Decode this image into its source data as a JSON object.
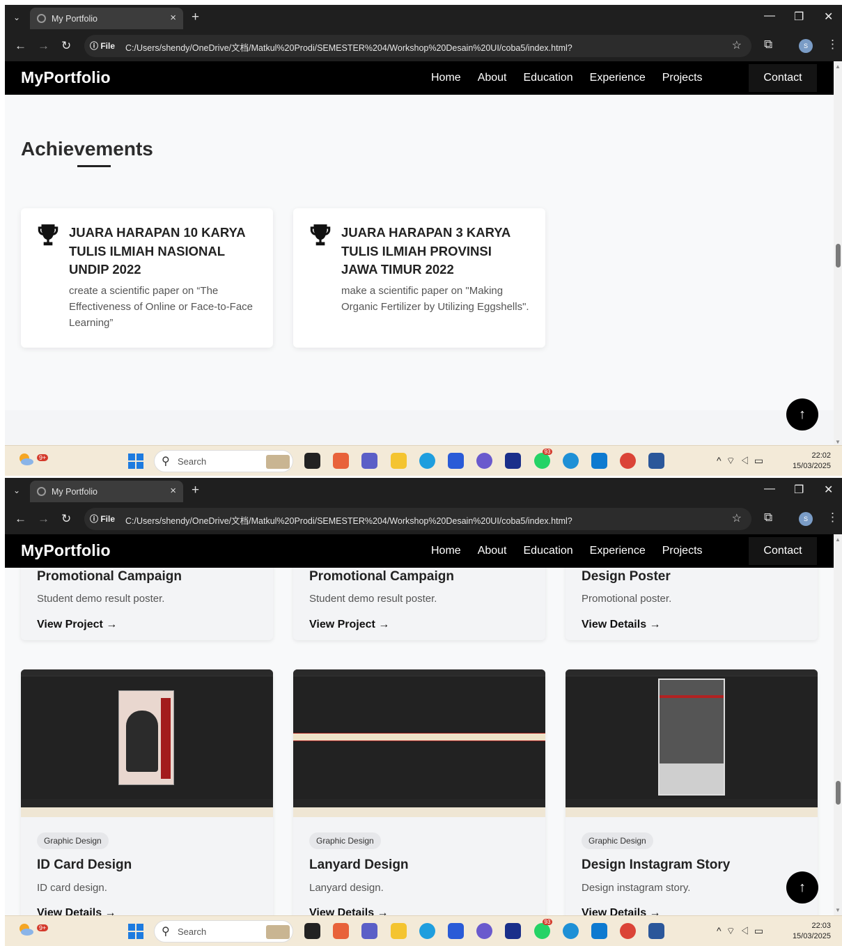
{
  "browser": {
    "tab_title": "My Portfolio",
    "url_chip": "File",
    "url": "C:/Users/shendy/OneDrive/文档/Matkul%20Prodi/SEMESTER%204/Workshop%20Desain%20UI/coba5/index.html?",
    "profile_initial": "S"
  },
  "site": {
    "logo": "MyPortfolio",
    "nav": [
      "Home",
      "About",
      "Education",
      "Experience",
      "Projects"
    ],
    "contact": "Contact"
  },
  "achievements": {
    "title": "Achievements",
    "items": [
      {
        "title": "JUARA HARAPAN 10 KARYA TULIS ILMIAH NASIONAL UNDIP 2022",
        "desc": "create a scientific paper on “The Effectiveness of Online or Face-to-Face Learning”"
      },
      {
        "title": "JUARA HARAPAN 3 KARYA TULIS ILMIAH PROVINSI JAWA TIMUR 2022",
        "desc": "make a scientific paper on \"Making Organic Fertilizer by Utilizing Eggshells\"."
      }
    ]
  },
  "projects": {
    "top": [
      {
        "title": "Promotional Campaign",
        "desc": "Student demo result poster.",
        "link": "View Project →"
      },
      {
        "title": "Promotional Campaign",
        "desc": "Student demo result poster.",
        "link": "View Project →"
      },
      {
        "title": "Design Poster",
        "desc": "Promotional poster.",
        "link": "View Details →"
      }
    ],
    "bottom": [
      {
        "tag": "Graphic Design",
        "title": "ID Card Design",
        "desc": "ID card design.",
        "link": "View Details →"
      },
      {
        "tag": "Graphic Design",
        "title": "Lanyard Design",
        "desc": "Lanyard design.",
        "link": "View Details →"
      },
      {
        "tag": "Graphic Design",
        "title": "Design Instagram Story",
        "desc": "Design instagram story.",
        "link": "View Details →"
      }
    ]
  },
  "taskbar": {
    "search": "Search",
    "weather_badge": "9+",
    "whatsapp_badge": "93",
    "clock1": {
      "time": "22:02",
      "date": "15/03/2025"
    },
    "clock2": {
      "time": "22:03",
      "date": "15/03/2025"
    }
  },
  "colors": {
    "nav_bg": "#000000",
    "page_bg": "#f8f9fa",
    "accent": "#000000"
  }
}
